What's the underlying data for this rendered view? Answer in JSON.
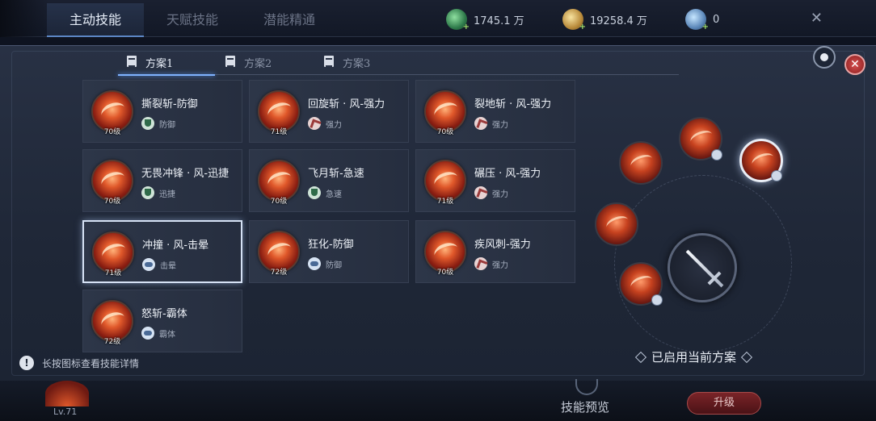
{
  "main_tabs": [
    {
      "label": "主动技能",
      "active": true
    },
    {
      "label": "天赋技能",
      "active": false
    },
    {
      "label": "潜能精通",
      "active": false
    }
  ],
  "currencies": [
    {
      "icon": "jade-icon",
      "value": "1745.1 万"
    },
    {
      "icon": "gold-coin-icon",
      "value": "19258.4 万"
    },
    {
      "icon": "gem-icon",
      "value": "0"
    }
  ],
  "plan_tabs": [
    {
      "label": "方案1",
      "active": true
    },
    {
      "label": "方案2",
      "active": false
    },
    {
      "label": "方案3",
      "active": false
    }
  ],
  "skills": [
    {
      "name": "撕裂斩-防御",
      "level": "70级",
      "tag": "防御",
      "tag_icon": "shield-icon"
    },
    {
      "name": "回旋斩 · 风-强力",
      "level": "71级",
      "tag": "强力",
      "tag_icon": "power-icon"
    },
    {
      "name": "裂地斩 · 风-强力",
      "level": "70级",
      "tag": "强力",
      "tag_icon": "power-icon"
    },
    {
      "name": "无畏冲锋 · 风-迅捷",
      "level": "70级",
      "tag": "迅捷",
      "tag_icon": "shield-icon"
    },
    {
      "name": "飞月斩-急速",
      "level": "70级",
      "tag": "急速",
      "tag_icon": "shield-icon"
    },
    {
      "name": "碾压 · 风-强力",
      "level": "71级",
      "tag": "强力",
      "tag_icon": "power-icon"
    },
    {
      "name": "冲撞 · 风-击晕",
      "level": "71级",
      "tag": "击晕",
      "tag_icon": "cloud-icon",
      "selected": true
    },
    {
      "name": "狂化-防御",
      "level": "72级",
      "tag": "防御",
      "tag_icon": "cloud-icon"
    },
    {
      "name": "疾风刺-强力",
      "level": "70级",
      "tag": "强力",
      "tag_icon": "power-icon"
    },
    {
      "name": "怒斩-霸体",
      "level": "72级",
      "tag": "霸体",
      "tag_icon": "cloud-icon"
    }
  ],
  "hint_text": "长按图标查看技能详情",
  "applied_text": "已启用当前方案",
  "bottom": {
    "hero_level": "Lv.71",
    "preview_label": "技能预览",
    "upgrade_label": "升级"
  },
  "colors": {
    "accent_blue": "#7fb2ff",
    "close_red": "#d85050",
    "upgrade_red": "#7a2428"
  }
}
